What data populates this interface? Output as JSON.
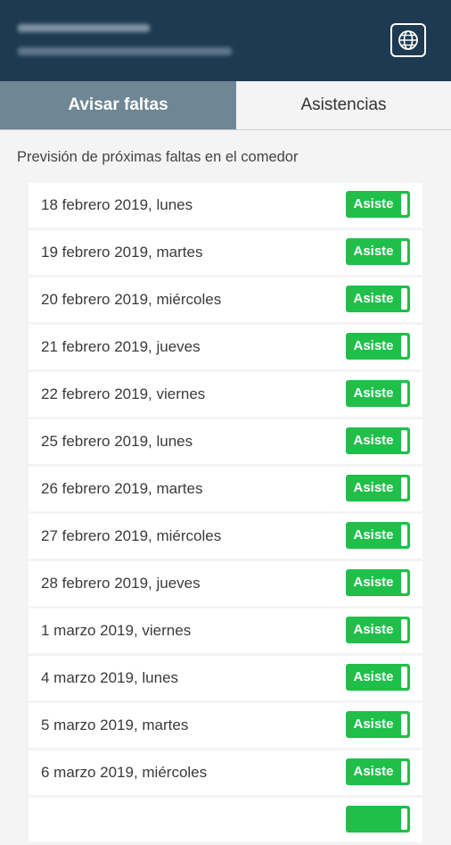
{
  "tabs": {
    "active": "Avisar faltas",
    "inactive": "Asistencias"
  },
  "section": {
    "title": "Previsión de próximas faltas en el comedor"
  },
  "colors": {
    "header": "#1d3a52",
    "active_tab": "#6f8694",
    "toggle": "#1fbf4a"
  },
  "icons": {
    "language": "globe-icon"
  },
  "days": [
    {
      "label": "18 febrero 2019, lunes",
      "status": "Asiste"
    },
    {
      "label": "19 febrero 2019, martes",
      "status": "Asiste"
    },
    {
      "label": "20 febrero 2019, miércoles",
      "status": "Asiste"
    },
    {
      "label": "21 febrero 2019, jueves",
      "status": "Asiste"
    },
    {
      "label": "22 febrero 2019, viernes",
      "status": "Asiste"
    },
    {
      "label": "25 febrero 2019, lunes",
      "status": "Asiste"
    },
    {
      "label": "26 febrero 2019, martes",
      "status": "Asiste"
    },
    {
      "label": "27 febrero 2019, miércoles",
      "status": "Asiste"
    },
    {
      "label": "28 febrero 2019, jueves",
      "status": "Asiste"
    },
    {
      "label": "1 marzo 2019, viernes",
      "status": "Asiste"
    },
    {
      "label": "4 marzo 2019, lunes",
      "status": "Asiste"
    },
    {
      "label": "5 marzo 2019, martes",
      "status": "Asiste"
    },
    {
      "label": "6 marzo 2019, miércoles",
      "status": "Asiste"
    },
    {
      "label": "",
      "status": ""
    }
  ]
}
